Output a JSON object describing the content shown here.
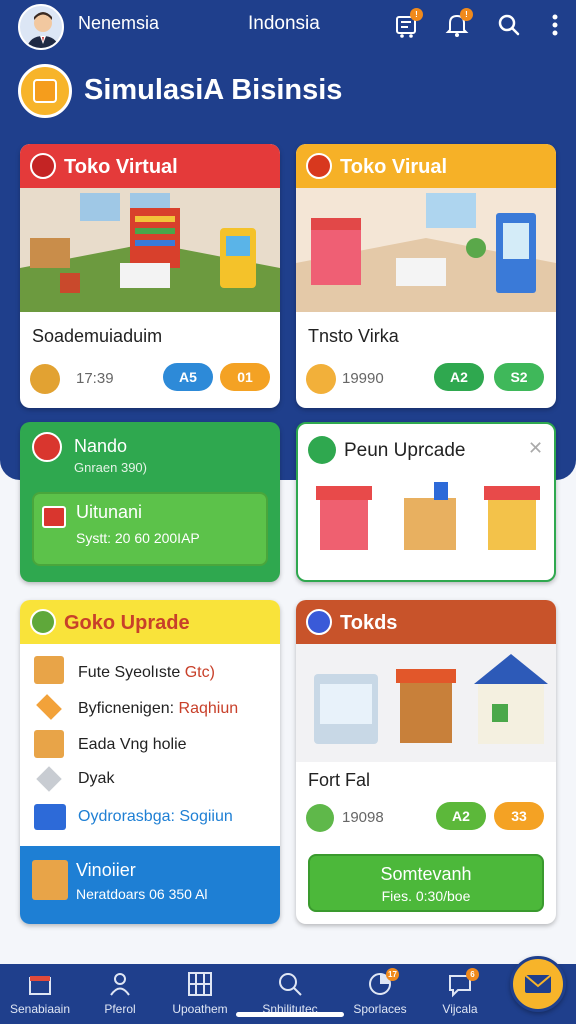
{
  "header": {
    "user_name": "Nenemsia",
    "region": "Indonsia",
    "icons": [
      "avatar",
      "shop-notify-icon",
      "bell-icon",
      "search-icon",
      "more-icon"
    ]
  },
  "page_title": "SimulasiA Bisinsis",
  "cards": {
    "toko1": {
      "title": "Toko Virtual",
      "label": "Soademuiaduim",
      "stat": "17:39",
      "pill1": "A5",
      "pill2": "01"
    },
    "toko2": {
      "title": "Toko Virual",
      "label": "Tnsto Virka",
      "stat": "19990",
      "pill1": "A2",
      "pill2": "S2"
    },
    "nando": {
      "title": "Nando",
      "subtitle": "Gnraen 390)",
      "btn_title": "Uitunani",
      "btn_sub": "Systt: 20 60 200IAP"
    },
    "upgrade": {
      "title": "Peun Uprcade",
      "close": "✕"
    },
    "goko": {
      "title": "Goko Uprade",
      "items": [
        {
          "text": "Fute Syeolıste",
          "extra": "Gtc)"
        },
        {
          "text": "Byficnenigen:",
          "extra": "Raqhiun"
        },
        {
          "text": "Eada Vng holie",
          "extra": ""
        },
        {
          "text": "Dyak",
          "extra": ""
        },
        {
          "text": "Oydrorasbga: Sogiiun",
          "extra": ""
        }
      ],
      "footer_title": "Vinoiier",
      "footer_sub": "Neratdoars 06 350 Al"
    },
    "tokds": {
      "title": "Tokds",
      "label": "Fort Fal",
      "stat": "19098",
      "pill1": "A2",
      "pill2": "33",
      "btn_title": "Somtevanh",
      "btn_sub": "Fies. 0:30/boe"
    }
  },
  "nav": [
    {
      "label": "Senabiaain",
      "icon": "shop-icon"
    },
    {
      "label": "Pferol",
      "icon": "person-icon"
    },
    {
      "label": "Upoathem",
      "icon": "grid-icon"
    },
    {
      "label": "Snhilitutec",
      "icon": "search-icon"
    },
    {
      "label": "Sporlaces",
      "icon": "chart-icon"
    },
    {
      "label": "Vijcala",
      "icon": "chat-icon"
    }
  ],
  "nav_badges": {
    "sporlaces": "17",
    "vijcala": "6"
  },
  "colors": {
    "primary": "#1f3f8c",
    "red": "#e43a3a",
    "orange": "#f4a224",
    "green": "#2fa84f",
    "yellow": "#f7d82a",
    "brown": "#c8532a",
    "blue": "#1e7fd4"
  }
}
